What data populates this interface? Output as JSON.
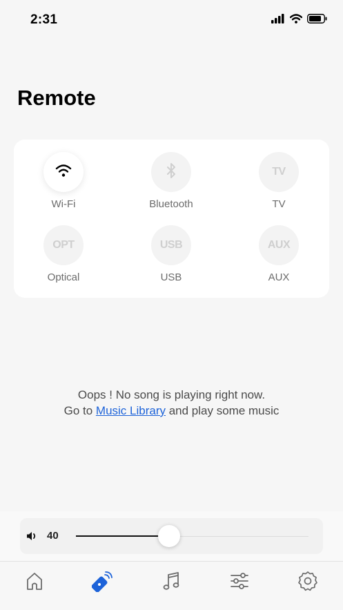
{
  "status_bar": {
    "time": "2:31",
    "icons": [
      "cellular-signal-icon",
      "wifi-icon",
      "battery-icon"
    ]
  },
  "page": {
    "title": "Remote"
  },
  "sources": {
    "items": [
      {
        "id": "wifi",
        "label": "Wi-Fi",
        "icon": "wifi-icon",
        "glyph": "",
        "active": true
      },
      {
        "id": "bluetooth",
        "label": "Bluetooth",
        "icon": "bluetooth-icon",
        "glyph": "",
        "active": false
      },
      {
        "id": "tv",
        "label": "TV",
        "icon": "tv-text-icon",
        "glyph": "TV",
        "active": false
      },
      {
        "id": "optical",
        "label": "Optical",
        "icon": "opt-text-icon",
        "glyph": "OPT",
        "active": false
      },
      {
        "id": "usb",
        "label": "USB",
        "icon": "usb-text-icon",
        "glyph": "USB",
        "active": false
      },
      {
        "id": "aux",
        "label": "AUX",
        "icon": "aux-text-icon",
        "glyph": "AUX",
        "active": false
      }
    ]
  },
  "empty_state": {
    "line1": "Oops ! No song is playing right now.",
    "line2_prefix": "Go to ",
    "link": "Music Library",
    "line2_suffix": " and play some music"
  },
  "volume": {
    "value": "40",
    "level_fraction": 0.4
  },
  "tabs": [
    {
      "id": "home",
      "icon": "home-icon",
      "active": false
    },
    {
      "id": "remote",
      "icon": "remote-icon",
      "active": true
    },
    {
      "id": "music",
      "icon": "music-note-icon",
      "active": false
    },
    {
      "id": "equalizer",
      "icon": "sliders-icon",
      "active": false
    },
    {
      "id": "settings",
      "icon": "gear-icon",
      "active": false
    }
  ],
  "colors": {
    "accent": "#1d63d9",
    "background": "#f6f6f6",
    "card": "#ffffff",
    "inactive_icon": "#cfcfcf"
  }
}
